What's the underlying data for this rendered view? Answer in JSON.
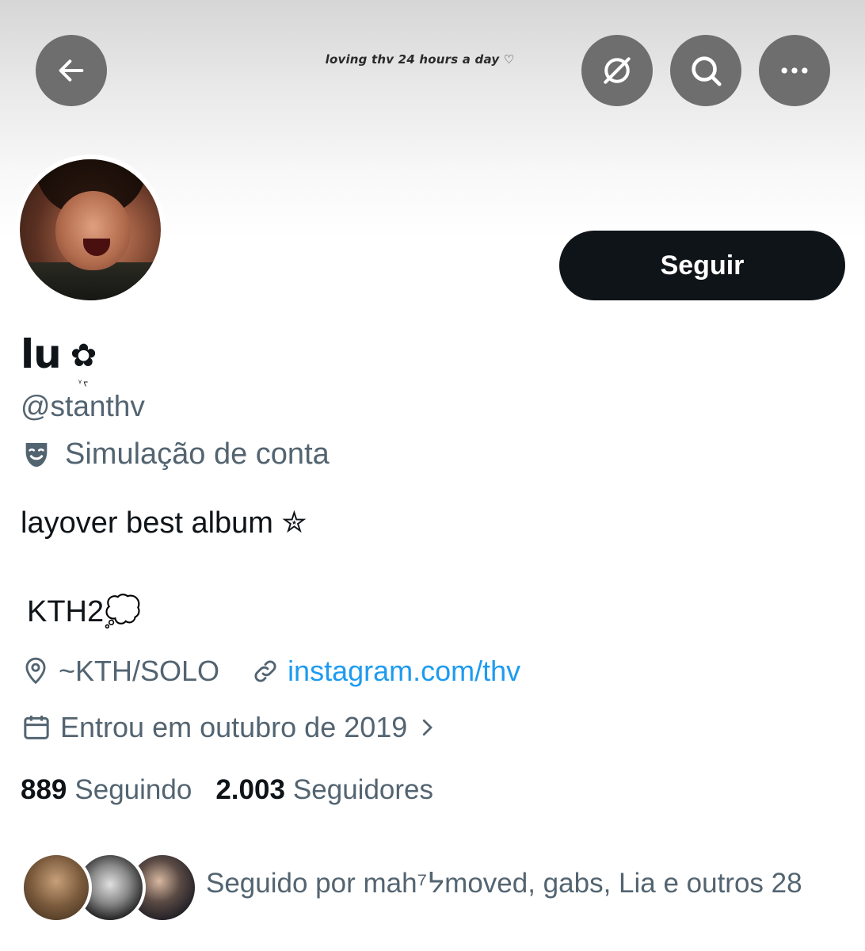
{
  "banner": {
    "text": "loving thv 24 hours a day ♡"
  },
  "header_buttons": {
    "back_icon": "arrow-left-icon",
    "grok_icon": "grok-icon",
    "search_icon": "search-icon",
    "more_icon": "more-horizontal-icon"
  },
  "profile": {
    "follow_label": "Seguir",
    "display_name": "lu",
    "name_decoration": "✿",
    "name_decoration_sub": "ᵞᡪ",
    "handle": "@stanthv",
    "parody_label": "Simulação de conta",
    "bio_line1": "layover best album ✮",
    "bio_line2": "KTH2💭",
    "location": "~KTH/SOLO",
    "website": "instagram.com/thv",
    "joined": "Entrou em outubro de 2019",
    "following_count": "889",
    "following_label": "Seguindo",
    "followers_count": "2.003",
    "followers_label": "Seguidores",
    "followed_by": "Seguido por mah⁷ᔭmoved, gabs, Lia e outros 28"
  },
  "colors": {
    "primary_text": "#0f1419",
    "secondary_text": "#536471",
    "link": "#1d9bf0",
    "header_button_bg": "#6e6e6e",
    "follow_button_bg": "#0f1419"
  }
}
